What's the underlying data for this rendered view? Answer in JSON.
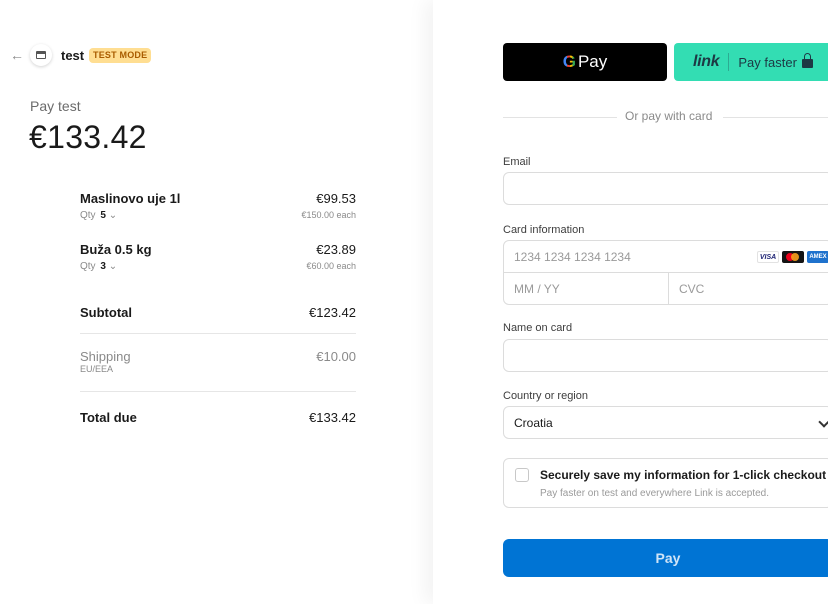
{
  "header": {
    "merchant_name": "test",
    "mode_badge": "TEST MODE",
    "back_icon": "arrow-left-icon",
    "logo_icon": "store-icon"
  },
  "summary": {
    "pay_label": "Pay test",
    "amount": "€133.42",
    "items": [
      {
        "name": "Maslinovo uje 1l",
        "total": "€99.53",
        "qty_label": "Qty",
        "qty": "5",
        "unit_price": "€150.00 each"
      },
      {
        "name": "Buža 0.5 kg",
        "total": "€23.89",
        "qty_label": "Qty",
        "qty": "3",
        "unit_price": "€60.00 each"
      }
    ],
    "subtotal_label": "Subtotal",
    "subtotal": "€123.42",
    "shipping_label": "Shipping",
    "shipping_region": "EU/EEA",
    "shipping": "€10.00",
    "total_label": "Total due",
    "total": "€133.42"
  },
  "payment": {
    "gpay_label": "Pay",
    "gpay_g": "G",
    "link_logo": "link",
    "link_label": "Pay faster",
    "or_text": "Or pay with card",
    "email_label": "Email",
    "email_value": "",
    "card_label": "Card information",
    "card_number_placeholder": "1234 1234 1234 1234",
    "expiry_placeholder": "MM / YY",
    "cvc_placeholder": "CVC",
    "card_brands": [
      "VISA",
      "Mastercard",
      "AMEX"
    ],
    "name_label": "Name on card",
    "name_value": "",
    "country_label": "Country or region",
    "country_value": "Croatia",
    "save_title": "Securely save my information for 1-click checkout",
    "save_subtitle": "Pay faster on test and everywhere Link is accepted.",
    "pay_button": "Pay"
  },
  "colors": {
    "accent": "#0074d4",
    "link_green": "#33ddb3",
    "badge_bg": "#ffde92",
    "badge_text": "#a95c00"
  }
}
